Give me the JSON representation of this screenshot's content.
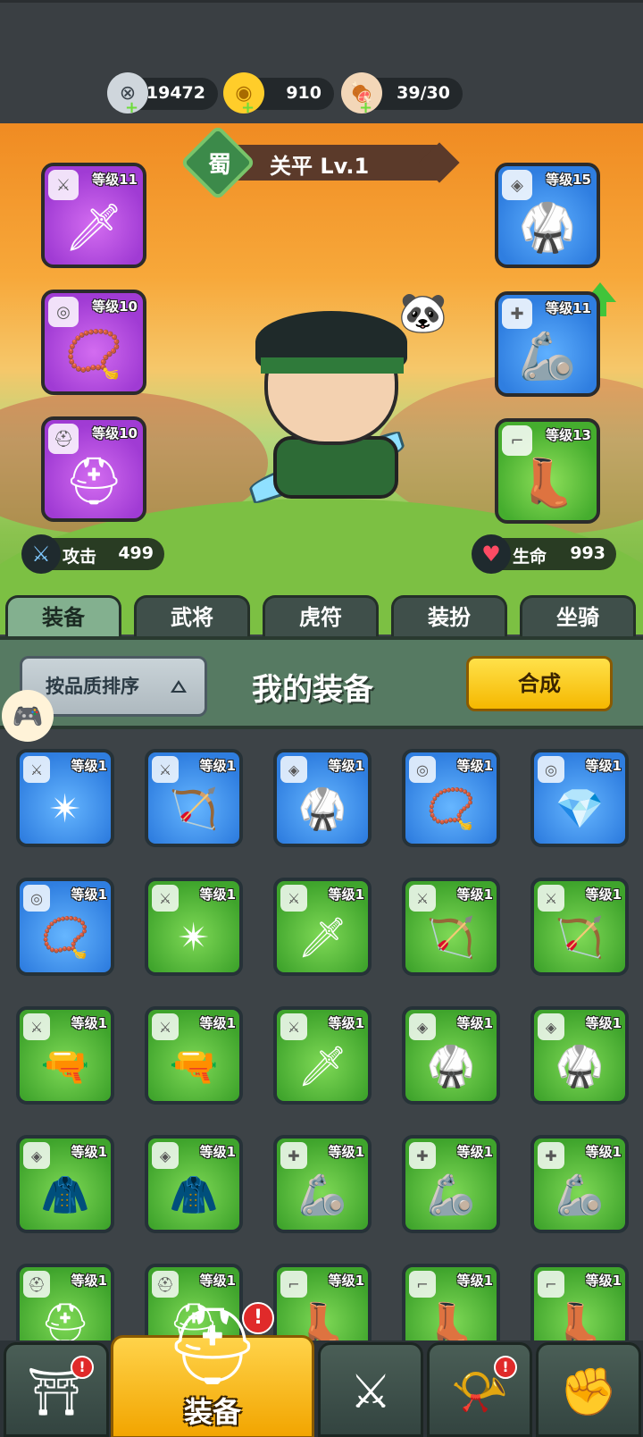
{
  "resources": [
    {
      "icon": "silver-coin-icon",
      "glyph": "⊗",
      "value": "19472"
    },
    {
      "icon": "gold-ingot-icon",
      "glyph": "◉",
      "value": "910"
    },
    {
      "icon": "meat-stamina-icon",
      "glyph": "🍖",
      "value": "39/30"
    }
  ],
  "hero": {
    "faction": "蜀",
    "name_level": "关平 Lv.1",
    "attack_label": "攻击",
    "attack_value": "499",
    "hp_label": "生命",
    "hp_value": "993"
  },
  "equipped": [
    {
      "slot": "weapon",
      "type_icon": "sword-icon",
      "type_glyph": "⚔",
      "level": "等级11",
      "rarity": "purple",
      "art": "🗡"
    },
    {
      "slot": "necklace",
      "type_icon": "medal-icon",
      "type_glyph": "◎",
      "level": "等级10",
      "rarity": "purple",
      "art": "📿"
    },
    {
      "slot": "helmet",
      "type_icon": "helmet-icon",
      "type_glyph": "⛑",
      "level": "等级10",
      "rarity": "purple",
      "art": "⛑"
    },
    {
      "slot": "armor",
      "type_icon": "armor-icon",
      "type_glyph": "◈",
      "level": "等级15",
      "rarity": "blue",
      "art": "🥋"
    },
    {
      "slot": "bracer",
      "type_icon": "bracer-icon",
      "type_glyph": "✚",
      "level": "等级11",
      "rarity": "blue",
      "art": "🦾"
    },
    {
      "slot": "boots",
      "type_icon": "boot-icon",
      "type_glyph": "⌐",
      "level": "等级13",
      "rarity": "green",
      "art": "👢"
    }
  ],
  "tabs": [
    "装备",
    "武将",
    "虎符",
    "装扮",
    "坐骑"
  ],
  "active_tab": 0,
  "panel": {
    "sort_label": "按品质排序",
    "title": "我的装备",
    "merge_label": "合成"
  },
  "inventory": [
    {
      "rarity": "blue",
      "type_icon": "sword-icon",
      "type_glyph": "⚔",
      "level": "等级1",
      "art": "✴"
    },
    {
      "rarity": "blue",
      "type_icon": "sword-icon",
      "type_glyph": "⚔",
      "level": "等级1",
      "art": "🏹"
    },
    {
      "rarity": "blue",
      "type_icon": "armor-icon",
      "type_glyph": "◈",
      "level": "等级1",
      "art": "🥋"
    },
    {
      "rarity": "blue",
      "type_icon": "medal-icon",
      "type_glyph": "◎",
      "level": "等级1",
      "art": "📿"
    },
    {
      "rarity": "blue",
      "type_icon": "medal-icon",
      "type_glyph": "◎",
      "level": "等级1",
      "art": "💎"
    },
    {
      "rarity": "blue",
      "type_icon": "medal-icon",
      "type_glyph": "◎",
      "level": "等级1",
      "art": "📿"
    },
    {
      "rarity": "green",
      "type_icon": "sword-icon",
      "type_glyph": "⚔",
      "level": "等级1",
      "art": "✴"
    },
    {
      "rarity": "green",
      "type_icon": "sword-icon",
      "type_glyph": "⚔",
      "level": "等级1",
      "art": "🗡"
    },
    {
      "rarity": "green",
      "type_icon": "sword-icon",
      "type_glyph": "⚔",
      "level": "等级1",
      "art": "🏹"
    },
    {
      "rarity": "green",
      "type_icon": "sword-icon",
      "type_glyph": "⚔",
      "level": "等级1",
      "art": "🏹"
    },
    {
      "rarity": "green",
      "type_icon": "sword-icon",
      "type_glyph": "⚔",
      "level": "等级1",
      "art": "🔫"
    },
    {
      "rarity": "green",
      "type_icon": "sword-icon",
      "type_glyph": "⚔",
      "level": "等级1",
      "art": "🔫"
    },
    {
      "rarity": "green",
      "type_icon": "sword-icon",
      "type_glyph": "⚔",
      "level": "等级1",
      "art": "🗡"
    },
    {
      "rarity": "green",
      "type_icon": "armor-icon",
      "type_glyph": "◈",
      "level": "等级1",
      "art": "🥋"
    },
    {
      "rarity": "green",
      "type_icon": "armor-icon",
      "type_glyph": "◈",
      "level": "等级1",
      "art": "🥋"
    },
    {
      "rarity": "green",
      "type_icon": "armor-icon",
      "type_glyph": "◈",
      "level": "等级1",
      "art": "🧥"
    },
    {
      "rarity": "green",
      "type_icon": "armor-icon",
      "type_glyph": "◈",
      "level": "等级1",
      "art": "🧥"
    },
    {
      "rarity": "green",
      "type_icon": "bracer-icon",
      "type_glyph": "✚",
      "level": "等级1",
      "art": "🦾"
    },
    {
      "rarity": "green",
      "type_icon": "bracer-icon",
      "type_glyph": "✚",
      "level": "等级1",
      "art": "🦾"
    },
    {
      "rarity": "green",
      "type_icon": "bracer-icon",
      "type_glyph": "✚",
      "level": "等级1",
      "art": "🦾"
    },
    {
      "rarity": "green",
      "type_icon": "helmet-icon",
      "type_glyph": "⛑",
      "level": "等级1",
      "art": "⛑"
    },
    {
      "rarity": "green",
      "type_icon": "helmet-icon",
      "type_glyph": "⛑",
      "level": "等级1",
      "art": "⛑"
    },
    {
      "rarity": "green",
      "type_icon": "boot-icon",
      "type_glyph": "⌐",
      "level": "等级1",
      "art": "👢"
    },
    {
      "rarity": "green",
      "type_icon": "boot-icon",
      "type_glyph": "⌐",
      "level": "等级1",
      "art": "👢"
    },
    {
      "rarity": "green",
      "type_icon": "boot-icon",
      "type_glyph": "⌐",
      "level": "等级1",
      "art": "👢"
    }
  ],
  "bottom_nav": [
    {
      "name": "nav-gate",
      "icon": "gate-icon",
      "glyph": "⛩",
      "badge": "!",
      "active": false
    },
    {
      "name": "nav-equipment",
      "icon": "helmet-icon",
      "glyph": "⛑",
      "label": "装备",
      "badge": "!",
      "active": true
    },
    {
      "name": "nav-battle",
      "icon": "crossed-swords-shield-icon",
      "glyph": "⚔",
      "active": false
    },
    {
      "name": "nav-summon",
      "icon": "horn-stars-icon",
      "glyph": "📯",
      "badge": "!",
      "active": false
    },
    {
      "name": "nav-upgrade",
      "icon": "fist-arrow-icon",
      "glyph": "✊",
      "active": false
    }
  ],
  "colors": {
    "rarity_purple": "#a03bd4",
    "rarity_blue": "#2f7ee0",
    "rarity_green": "#45ad2e",
    "merge_button": "#f5b800",
    "panel_green": "#567a62"
  }
}
